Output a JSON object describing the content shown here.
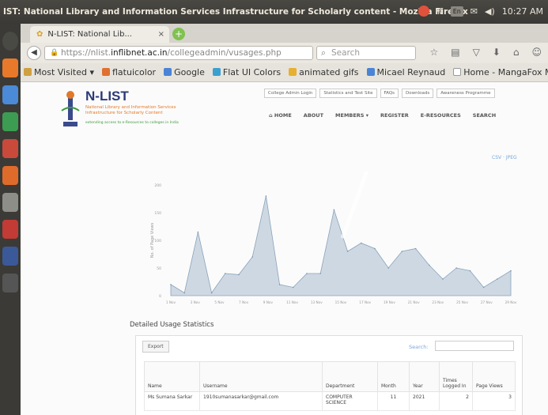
{
  "window": {
    "title": "IST: National Library and Information Services Infrastructure for Scholarly content - Mozilla Firefox",
    "clock": "10:27 AM"
  },
  "tray": {
    "keyboard": "En"
  },
  "browser": {
    "tab_title": "N-LIST: National Lib...",
    "tab_close": "×",
    "new_tab": "+",
    "url_prefix": "https://nlist.",
    "url_domain": "inflibnet.ac.in",
    "url_path": "/collegeadmin/vusages.php",
    "search_placeholder": "Search",
    "bookmarks": [
      {
        "label": "Most Visited",
        "color": "#d0a040"
      },
      {
        "label": "flatuicolor",
        "color": "#e07030"
      },
      {
        "label": "Google",
        "color": "#4a84d6"
      },
      {
        "label": "Flat UI Colors",
        "color": "#3aa0d0"
      },
      {
        "label": "animated gifs",
        "color": "#e8b030"
      },
      {
        "label": "Micael Reynaud",
        "color": "#4a84d6"
      },
      {
        "label": "Home - MangaFox Mo...",
        "color": "#ffffff"
      }
    ]
  },
  "site": {
    "logo_title": "N-LIST",
    "logo_sub": "National Library and Information Services Infrastructure for Scholarly Content",
    "logo_tag": "extending access to e-Resources to colleges in India",
    "top_links": [
      "College Admin Login",
      "Statistics and Test Site",
      "FAQs",
      "Downloads",
      "Awareness Programme"
    ],
    "nav": [
      "HOME",
      "ABOUT",
      "MEMBERS",
      "REGISTER",
      "E-RESOURCES",
      "SEARCH"
    ],
    "export_links": "CSV · JPEG"
  },
  "chart_data": {
    "type": "area",
    "ylabel": "No. of Page Views",
    "ylim": [
      0,
      200
    ],
    "yticks": [
      0,
      50,
      100,
      150,
      200
    ],
    "x": [
      "1 Nov",
      "3 Nov",
      "5 Nov",
      "7 Nov",
      "9 Nov",
      "11 Nov",
      "13 Nov",
      "15 Nov",
      "17 Nov",
      "19 Nov",
      "21 Nov",
      "23 Nov",
      "25 Nov",
      "27 Nov",
      "29 Nov"
    ],
    "values": [
      20,
      5,
      115,
      5,
      40,
      38,
      70,
      180,
      20,
      15,
      40,
      40,
      155,
      80,
      95,
      85,
      50,
      80,
      85,
      55,
      30,
      50,
      45,
      15,
      30,
      45
    ],
    "color": "#a9bcd0",
    "grid": false
  },
  "usage": {
    "title": "Detailed Usage Statistics",
    "export_label": "Export",
    "search_label": "Search:",
    "columns": [
      "Name",
      "Username",
      "Department",
      "Month",
      "Year",
      "Times Logged In",
      "Page Views"
    ],
    "rows": [
      [
        "Ms Sumana Sarkar",
        "1910sumanasarkar@gmail.com",
        "COMPUTER SCIENCE",
        "11",
        "2021",
        "2",
        "3"
      ]
    ]
  }
}
